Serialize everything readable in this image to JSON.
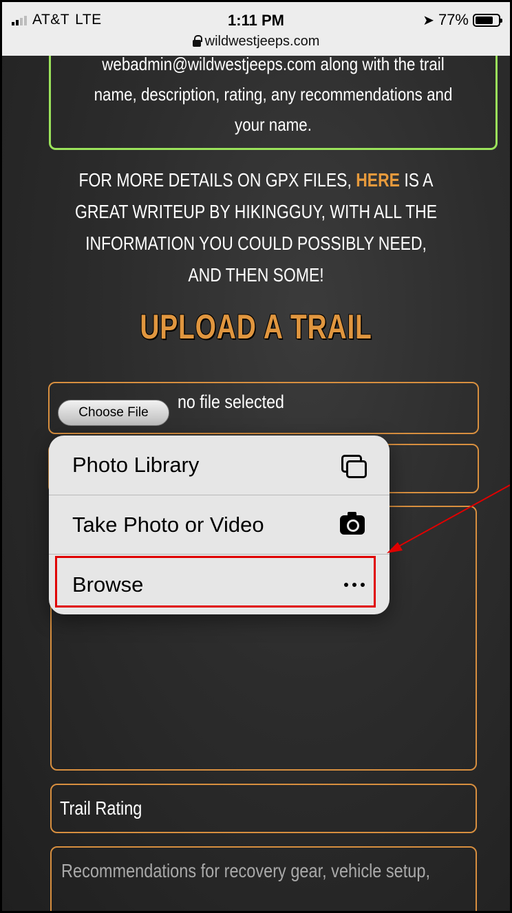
{
  "status_bar": {
    "carrier": "AT&T",
    "network": "LTE",
    "time": "1:11 PM",
    "battery": "77%",
    "battery_level": 0.77,
    "url": "wildwestjeeps.com"
  },
  "content": {
    "green_box_text": "webadmin@wildwestjeeps.com along with the trail name, description, rating, any recommendations and your name.",
    "gpx_before": "For more details on GPX files, ",
    "gpx_link": "HERE",
    "gpx_after": " is a great writeup by HikingGuy, with all the information you could possibly need, and then some!",
    "section_title": "UPLOAD A TRAIL"
  },
  "form": {
    "choose_file_label": "Choose File",
    "file_status": "no file selected",
    "trail_rating_label": "Trail Rating",
    "recommendations_placeholder": "Recommendations for recovery gear, vehicle setup,"
  },
  "menu": {
    "items": [
      {
        "label": "Photo Library",
        "icon": "photo-library-icon"
      },
      {
        "label": "Take Photo or Video",
        "icon": "camera-icon"
      },
      {
        "label": "Browse",
        "icon": "more-icon"
      }
    ]
  },
  "colors": {
    "accent_orange": "#e0963f",
    "green_border": "#9be35b",
    "annotation_red": "#e00000"
  }
}
